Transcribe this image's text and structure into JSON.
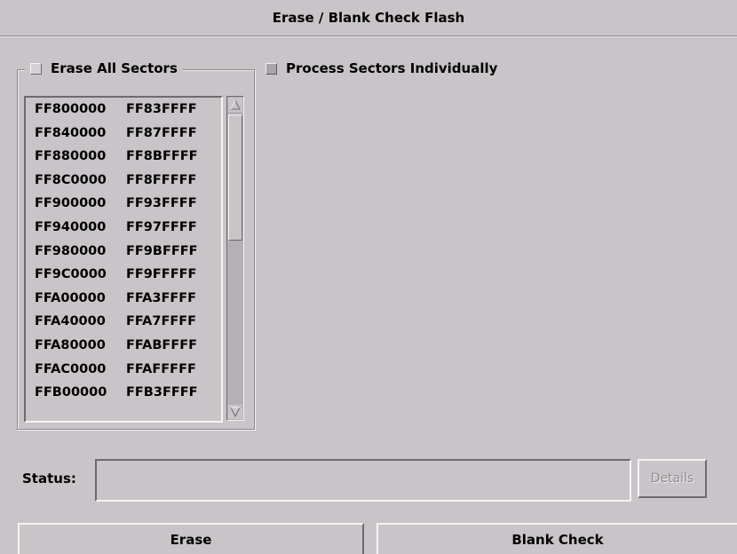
{
  "window": {
    "title": "Erase / Blank Check Flash"
  },
  "erase_all": {
    "label": "Erase All Sectors"
  },
  "process_individually": {
    "label": "Process Sectors Individually"
  },
  "sectors": [
    {
      "start": "FF800000",
      "end": "FF83FFFF"
    },
    {
      "start": "FF840000",
      "end": "FF87FFFF"
    },
    {
      "start": "FF880000",
      "end": "FF8BFFFF"
    },
    {
      "start": "FF8C0000",
      "end": "FF8FFFFF"
    },
    {
      "start": "FF900000",
      "end": "FF93FFFF"
    },
    {
      "start": "FF940000",
      "end": "FF97FFFF"
    },
    {
      "start": "FF980000",
      "end": "FF9BFFFF"
    },
    {
      "start": "FF9C0000",
      "end": "FF9FFFFF"
    },
    {
      "start": "FFA00000",
      "end": "FFA3FFFF"
    },
    {
      "start": "FFA40000",
      "end": "FFA7FFFF"
    },
    {
      "start": "FFA80000",
      "end": "FFABFFFF"
    },
    {
      "start": "FFAC0000",
      "end": "FFAFFFFF"
    },
    {
      "start": "FFB00000",
      "end": "FFB3FFFF"
    }
  ],
  "status": {
    "label": "Status:",
    "value": ""
  },
  "buttons": {
    "details": "Details",
    "erase": "Erase",
    "blank_check": "Blank Check"
  },
  "icons": {
    "scroll_up": "scroll-up-arrow-icon",
    "scroll_down": "scroll-down-arrow-icon"
  }
}
